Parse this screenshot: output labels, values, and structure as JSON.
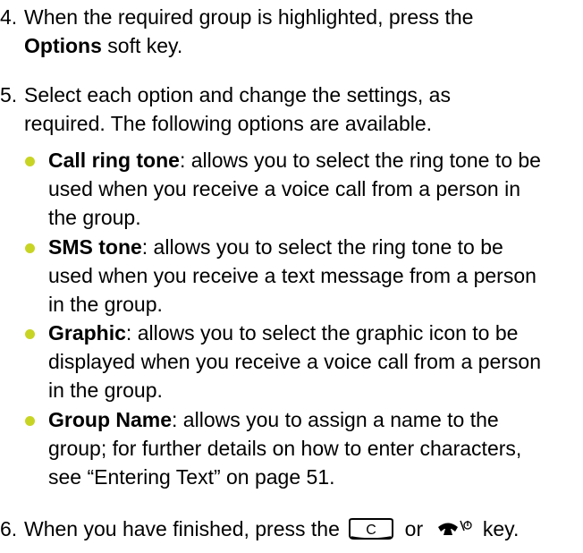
{
  "colors": {
    "bullet": "#c8d424",
    "text": "#000000"
  },
  "steps": [
    {
      "number": "4.",
      "lines": [
        "When the required group is highlighted, press the",
        {
          "bold": "Options",
          "rest": " soft key."
        }
      ]
    },
    {
      "number": "5.",
      "lines": [
        "Select each option and change the settings, as",
        "required. The following options are available."
      ]
    },
    {
      "number": "6.",
      "before": "When you have finished, press the ",
      "middle": " or ",
      "after": " key.",
      "keys": [
        "c-key-icon",
        "end-key-icon"
      ],
      "c_key_letter": "C"
    }
  ],
  "options": [
    {
      "name": "Call ring tone",
      "lines": [
        ": allows you to select the ring tone to be",
        "used when you receive a voice call from a person in",
        "the group."
      ]
    },
    {
      "name": "SMS tone",
      "lines": [
        ": allows you to select the ring tone to be",
        "used when you receive a text message from a person",
        "in the group."
      ]
    },
    {
      "name": "Graphic",
      "lines": [
        ": allows you to select the graphic icon to be",
        "displayed when you receive a voice call from a person",
        "in the group."
      ]
    },
    {
      "name": "Group Name",
      "lines": [
        ": allows you to assign a name to the",
        "group; for further details on how to enter characters,",
        "see “Entering Text” on page 51."
      ]
    }
  ]
}
